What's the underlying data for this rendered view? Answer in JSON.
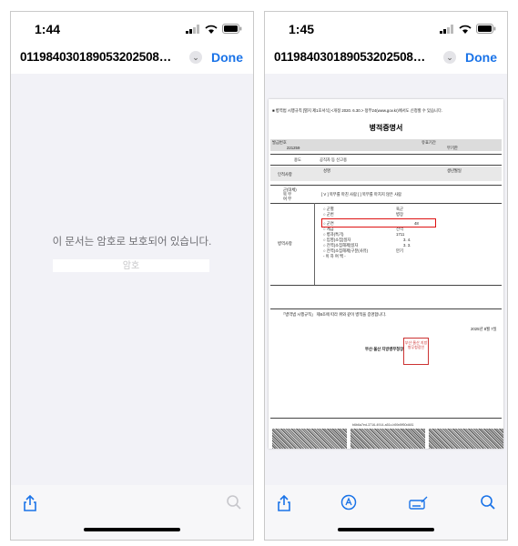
{
  "left": {
    "status": {
      "time": "1:44"
    },
    "nav": {
      "title": "011984030189053202508…",
      "done_label": "Done"
    },
    "locked_message": "이 문서는 암호로 보호되어 있습니다.",
    "password_placeholder": "암호",
    "toolbar": {
      "icons": [
        "share-icon",
        "search-icon"
      ]
    }
  },
  "right": {
    "status": {
      "time": "1:45"
    },
    "nav": {
      "title": "011984030189053202508…",
      "done_label": "Done"
    },
    "toolbar": {
      "icons": [
        "share-icon",
        "markup-icon",
        "signature-icon",
        "search-icon"
      ]
    },
    "certificate": {
      "header_note": "■ 병역법 시행규칙 [별지 제1호서식] <개정 2020. 6.30.> 정부24(www.gov.kr)에서도 신청할 수 있습니다.",
      "title": "병적증명서",
      "issue_no_label": "발급번호",
      "issue_no": "221259",
      "validity_label": "유효기간",
      "validity_value": "무기한",
      "purpose_label": "용도",
      "purpose_value": "공직자 등 신고용",
      "person_label": "인적사항",
      "name_label": "성명",
      "birth_label": "생년월일",
      "duty_label_1": "군(대체)",
      "duty_label_2": "복    무",
      "duty_label_3": "여    부",
      "duty_options": "[ V ] 복무를 마친 사람  [ ] 복무를 마치지 않은 사람",
      "service_label": "병역사항",
      "service_items": [
        {
          "key": "○ 군별",
          "value": "육군"
        },
        {
          "key": "○ 군번",
          "value": ""
        },
        {
          "key": "○ 구분",
          "value": ""
        },
        {
          "key": "○ 계급",
          "value": "병장"
        },
        {
          "key": "○ 군연",
          "value": "48"
        },
        {
          "key": "○ 병과(특기)",
          "value": "1711"
        },
        {
          "key": "○ 입영(소집)일자",
          "value": "3. 4."
        },
        {
          "key": "○ 전역(소집해제)일자",
          "value": "3. 3."
        },
        {
          "key": "○ 전역(소집해제)구분(사유)",
          "value": "만기"
        },
        {
          "key": "- 이 하 여 백 -",
          "value": ""
        }
      ],
      "extra_value": "전역",
      "certify_text": "「병역법 시행규칙」 제8조에 따라 위와 같이 병적을 증명합니다.",
      "date": "2025년  8월  7일",
      "office": "부산·울산 지방병무청장",
      "seal_text": "부산·울산 지방병무청장인",
      "barcode_id": "b6b6a7ed-3716-4914-a51c-b59d9f50d481"
    }
  },
  "colors": {
    "accent": "#1a73e8",
    "seal": "#cc3333",
    "highlight": "#dd1111"
  }
}
